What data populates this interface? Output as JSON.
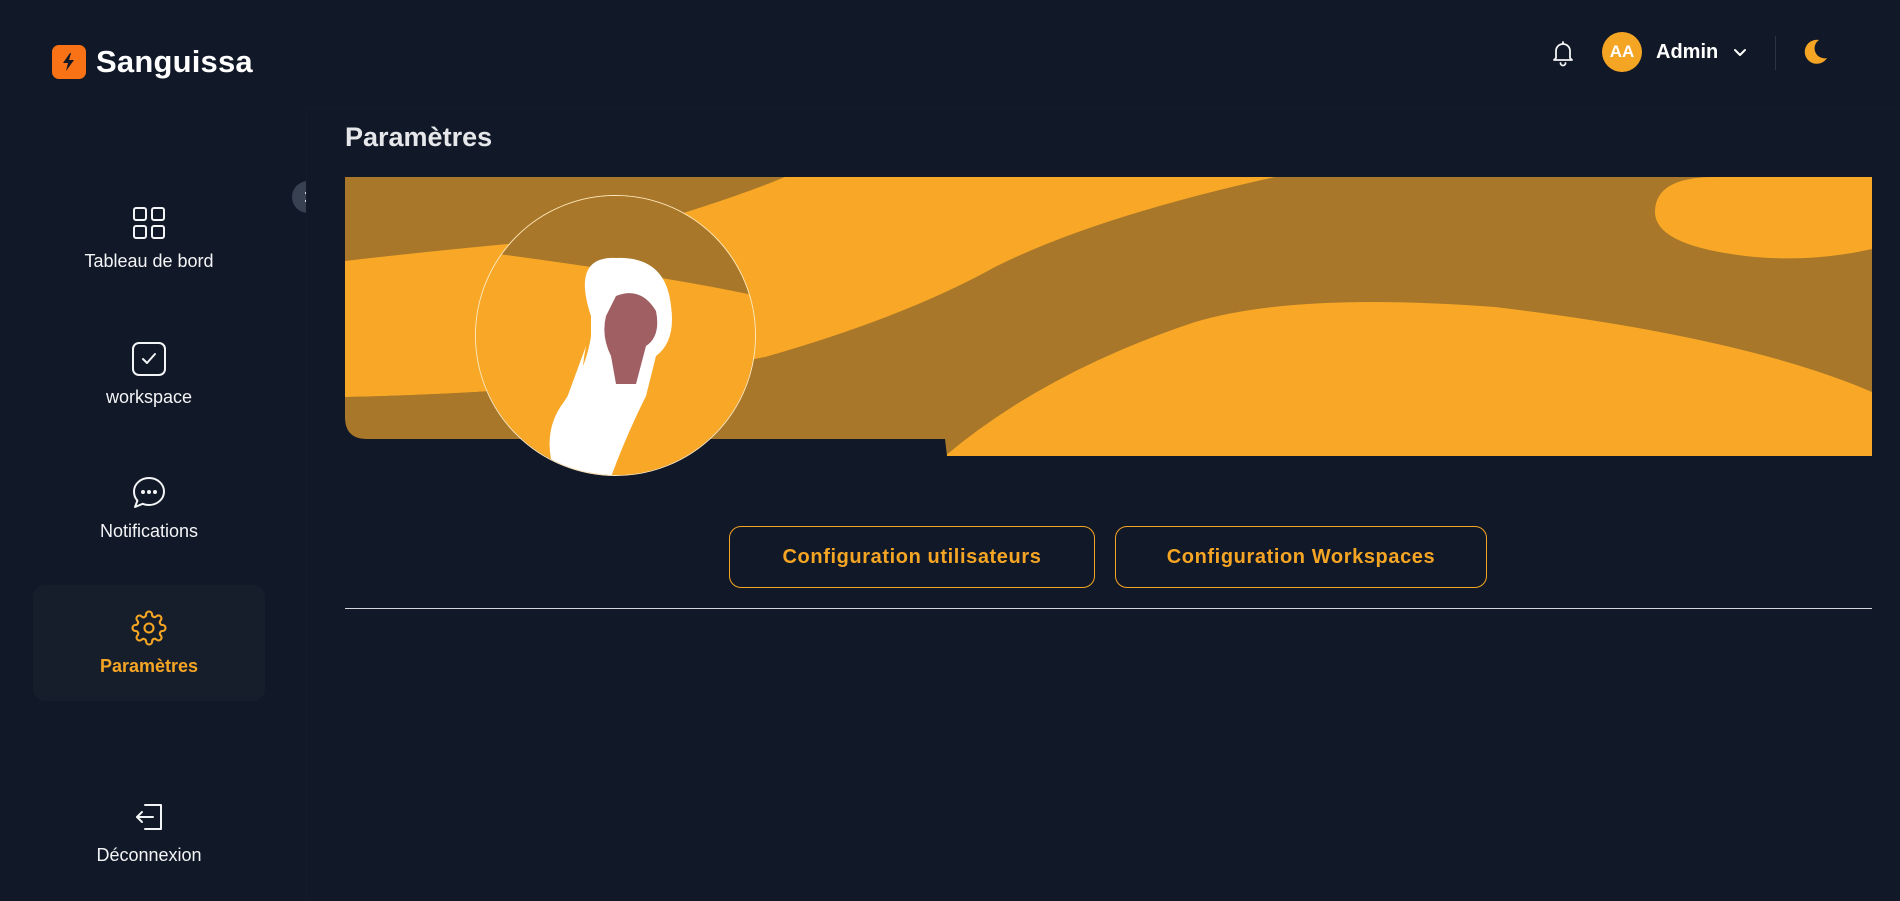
{
  "brand": {
    "name": "Sanguissa",
    "accent": "#f97316"
  },
  "sidebar": {
    "items": [
      {
        "label": "Tableau de bord",
        "icon": "dashboard-grid-icon"
      },
      {
        "label": "workspace",
        "icon": "checkbox-check-icon"
      },
      {
        "label": "Notifications",
        "icon": "chat-bubble-icon"
      },
      {
        "label": "Paramètres",
        "icon": "gear-icon",
        "active": true
      }
    ],
    "logout": {
      "label": "Déconnexion",
      "icon": "logout-icon"
    }
  },
  "header": {
    "user": {
      "initials": "AA",
      "name": "Admin"
    },
    "icons": {
      "notifications": "bell-icon",
      "theme": "moon-icon",
      "menu": "chevron-down-icon"
    }
  },
  "page": {
    "title": "Paramètres",
    "buttons": {
      "users": "Configuration utilisateurs",
      "workspaces": "Configuration Workspaces"
    }
  },
  "colors": {
    "background": "#111827",
    "accent": "#f5a524",
    "banner_dark": "#a8772a",
    "banner_light": "#f8a826"
  }
}
